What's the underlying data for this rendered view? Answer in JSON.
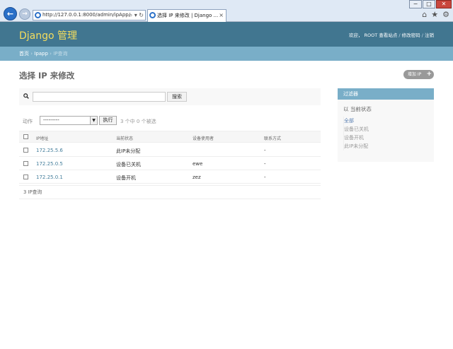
{
  "browser": {
    "url": "http://127.0.0.1:8000/admin/ipApp/",
    "tab_title": "选择 IP 来修改 | Django ...",
    "tab_close": "×",
    "window_min": "−",
    "window_max": "□",
    "window_close": "✕"
  },
  "header": {
    "branding": "Django 管理",
    "user_tools": {
      "welcome": "欢迎，",
      "user": "ROOT",
      "view_site": "查看站点",
      "change_password": "修改密码",
      "logout": "注销"
    }
  },
  "breadcrumbs": {
    "home": "首页",
    "app": "Ipapp",
    "model": "IP查询",
    "sep": " › "
  },
  "content": {
    "title": "选择 IP 来修改",
    "add_button": "增加 IP",
    "search_button": "搜索",
    "search_value": "",
    "actions_label": "动作",
    "action_selected": "---------",
    "go_button": "执行",
    "selection_count": "3 个中 0 个被选",
    "columns": [
      "IP地址",
      "当前状态",
      "设备使用者",
      "联系方式"
    ],
    "rows": [
      {
        "ip": "172.25.5.6",
        "status": "此IP未分配",
        "user": "",
        "contact": "-"
      },
      {
        "ip": "172.25.0.5",
        "status": "设备已关机",
        "user": "ewe",
        "contact": "-"
      },
      {
        "ip": "172.25.0.1",
        "status": "设备开机",
        "user": "zez",
        "contact": "-"
      }
    ],
    "paginator": "3 IP查询"
  },
  "filter": {
    "title": "过滤器",
    "subtitle": "以 当前状态",
    "items": [
      "全部",
      "设备已关机",
      "设备开机",
      "此IP未分配"
    ]
  }
}
